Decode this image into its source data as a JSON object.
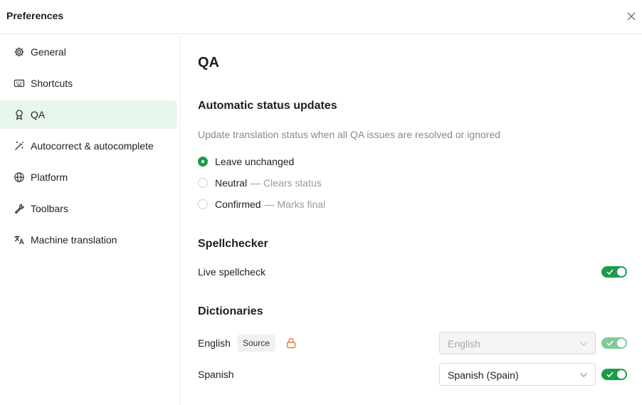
{
  "header": {
    "title": "Preferences"
  },
  "sidebar": {
    "items": [
      {
        "label": "General",
        "icon": "gear-icon"
      },
      {
        "label": "Shortcuts",
        "icon": "keyboard-icon"
      },
      {
        "label": "QA",
        "icon": "award-icon",
        "active": true
      },
      {
        "label": "Autocorrect & autocomplete",
        "icon": "magic-wand-icon"
      },
      {
        "label": "Platform",
        "icon": "globe-icon"
      },
      {
        "label": "Toolbars",
        "icon": "wrench-icon"
      },
      {
        "label": "Machine translation",
        "icon": "translate-icon"
      }
    ]
  },
  "main": {
    "title": "QA",
    "status": {
      "heading": "Automatic status updates",
      "description": "Update translation status when all QA issues are resolved or ignored",
      "options": [
        {
          "label": "Leave unchanged",
          "hint": "",
          "checked": true
        },
        {
          "label": "Neutral",
          "hint": "— Clears status",
          "checked": false
        },
        {
          "label": "Confirmed",
          "hint": "— Marks final",
          "checked": false
        }
      ]
    },
    "spellchecker": {
      "heading": "Spellchecker",
      "live_label": "Live spellcheck",
      "live_enabled": true
    },
    "dictionaries": {
      "heading": "Dictionaries",
      "rows": [
        {
          "language": "English",
          "badge": "Source",
          "locked": true,
          "selected": "English",
          "enabled": true,
          "disabled": true
        },
        {
          "language": "Spanish",
          "badge": "",
          "locked": false,
          "selected": "Spanish (Spain)",
          "enabled": true,
          "disabled": false
        }
      ]
    }
  },
  "colors": {
    "accent": "#1a9c4b",
    "active_bg": "#e8f5ec",
    "lock": "#f07a3a"
  }
}
